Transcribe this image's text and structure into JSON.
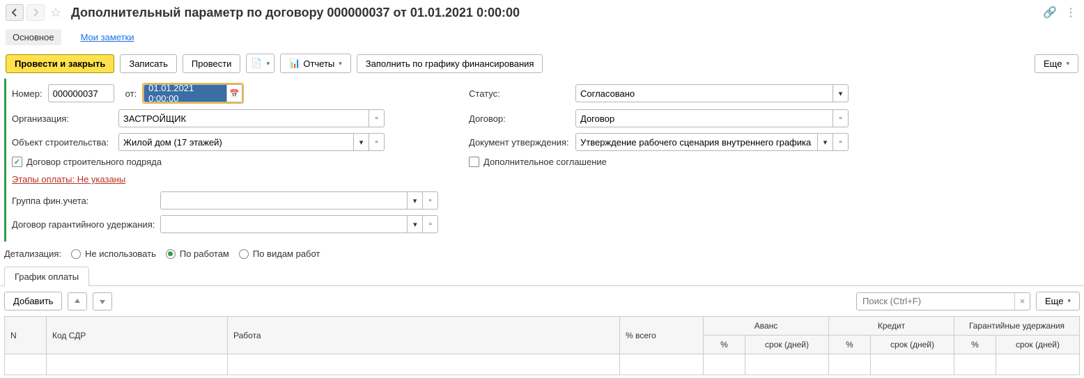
{
  "header": {
    "title": "Дополнительный параметр по договору 000000037 от 01.01.2021 0:00:00"
  },
  "subnav": {
    "main": "Основное",
    "notes": "Мои заметки"
  },
  "toolbar": {
    "post_close": "Провести и закрыть",
    "save": "Записать",
    "post": "Провести",
    "reports": "Отчеты",
    "fill_schedule": "Заполнить по графику финансирования",
    "more": "Еще"
  },
  "form": {
    "number_label": "Номер:",
    "number_value": "000000037",
    "date_label": "от:",
    "date_value": "01.01.2021  0:00:00",
    "status_label": "Статус:",
    "status_value": "Согласовано",
    "org_label": "Организация:",
    "org_value": "ЗАСТРОЙЩИК",
    "contract_label": "Договор:",
    "contract_value": "Договор",
    "object_label": "Объект строительства:",
    "object_value": "Жилой дом (17 этажей)",
    "approval_doc_label": "Документ утверждения:",
    "approval_doc_value": "Утверждение рабочего сценария внутреннего графика работ",
    "construction_contract_check": "Договор строительного подряда",
    "additional_agreement_check": "Дополнительное соглашение",
    "payment_stages_link": "Этапы оплаты: Не указаны",
    "fin_group_label": "Группа фин.учета:",
    "fin_group_value": "",
    "guarantee_contract_label": "Договор гарантийного удержания:",
    "guarantee_contract_value": ""
  },
  "detail": {
    "label": "Детализация:",
    "opt_none": "Не использовать",
    "opt_works": "По работам",
    "opt_work_types": "По видам работ"
  },
  "tabs": {
    "payment_schedule": "График оплаты"
  },
  "table_toolbar": {
    "add": "Добавить",
    "search_placeholder": "Поиск (Ctrl+F)",
    "more": "Еще"
  },
  "table": {
    "headers": {
      "n": "N",
      "sdr_code": "Код СДР",
      "work": "Работа",
      "pct_total": "% всего",
      "advance": "Аванс",
      "credit": "Кредит",
      "guarantee": "Гарантийные удержания",
      "pct": "%",
      "term_days": "срок (дней)"
    }
  }
}
